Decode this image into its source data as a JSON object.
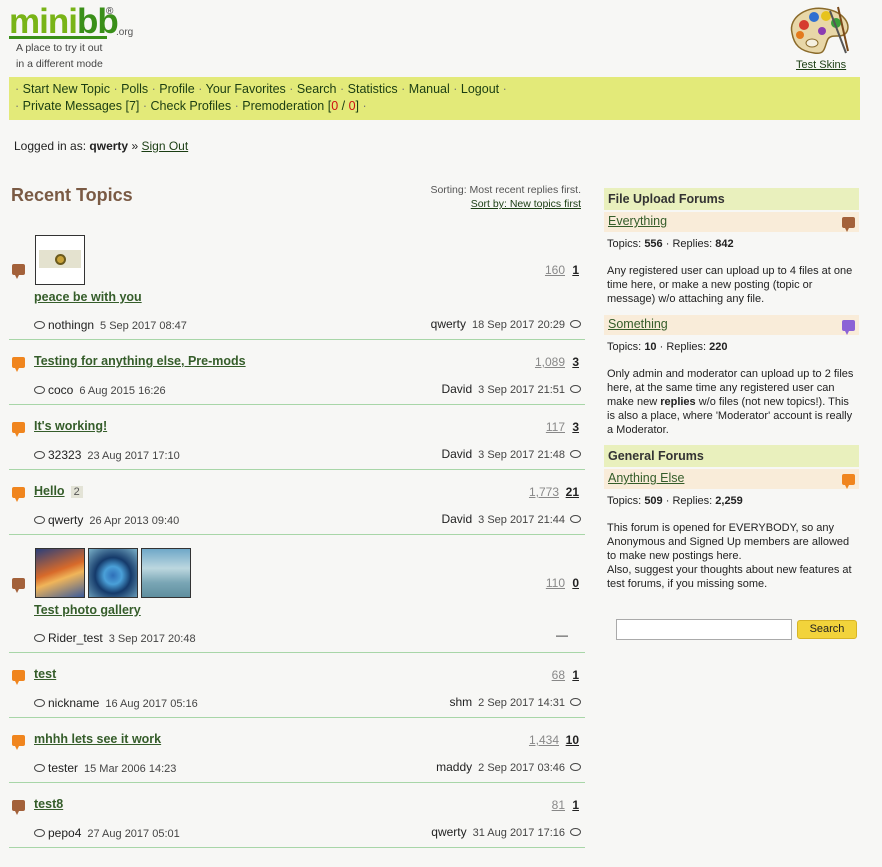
{
  "header": {
    "logo_mini": "mini",
    "logo_bb": "bb",
    "logo_reg": "®",
    "logo_org": ".org",
    "tagline_line1": "A place to try it out",
    "tagline_line2": "in a different mode",
    "test_skins": "Test Skins"
  },
  "nav": {
    "items": [
      "Start New Topic",
      "Polls",
      "Profile",
      "Your Favorites",
      "Search",
      "Statistics",
      "Manual",
      "Logout"
    ],
    "private_messages": "Private Messages",
    "private_count": "[7]",
    "check_profiles": "Check Profiles",
    "premoderation": "Premoderation",
    "premod_a": "0",
    "premod_b": "0"
  },
  "login": {
    "prefix": "Logged in as:",
    "user": "qwerty",
    "sep": "»",
    "sign_out": "Sign Out"
  },
  "recent": {
    "title": "Recent Topics",
    "sorting": "Sorting: Most recent replies first.",
    "sort_link": "Sort by: New topics first"
  },
  "topics": [
    {
      "title": "peace be with you",
      "views": "160",
      "replies": "1",
      "author": "nothingn",
      "author_date": "5 Sep 2017 08:47",
      "last_user": "qwerty",
      "last_date": "18 Sep 2017 20:29",
      "icon": "brown"
    },
    {
      "title": "Testing for anything else, Pre-mods",
      "views": "1,089",
      "replies": "3",
      "author": "coco",
      "author_date": "6 Aug 2015 16:26",
      "last_user": "David",
      "last_date": "3 Sep 2017 21:51",
      "icon": "orange"
    },
    {
      "title": "It's working!",
      "views": "117",
      "replies": "3",
      "author": "32323",
      "author_date": "23 Aug 2017 17:10",
      "last_user": "David",
      "last_date": "3 Sep 2017 21:48",
      "icon": "orange"
    },
    {
      "title": "Hello",
      "pages": "2",
      "views": "1,773",
      "replies": "21",
      "author": "qwerty",
      "author_date": "26 Apr 2013 09:40",
      "last_user": "David",
      "last_date": "3 Sep 2017 21:44",
      "icon": "orange"
    },
    {
      "title": "Test photo gallery",
      "views": "110",
      "replies": "0",
      "author": "Rider_test",
      "author_date": "3 Sep 2017 20:48",
      "last_dash": "—",
      "icon": "brown"
    },
    {
      "title": "test",
      "views": "68",
      "replies": "1",
      "author": "nickname",
      "author_date": "16 Aug 2017 05:16",
      "last_user": "shm",
      "last_date": "2 Sep 2017 14:31",
      "icon": "orange"
    },
    {
      "title": "mhhh lets see it work",
      "views": "1,434",
      "replies": "10",
      "author": "tester",
      "author_date": "15 Mar 2006 14:23",
      "last_user": "maddy",
      "last_date": "2 Sep 2017 03:46",
      "icon": "orange"
    },
    {
      "title": "test8",
      "views": "81",
      "replies": "1",
      "author": "pepo4",
      "author_date": "27 Aug 2017 05:01",
      "last_user": "qwerty",
      "last_date": "31 Aug 2017 17:16",
      "icon": "brown"
    }
  ],
  "sidebar": {
    "group1": "File Upload Forums",
    "forum1": {
      "name": "Everything",
      "topics_label": "Topics:",
      "topics": "556",
      "replies_label": "Replies:",
      "replies": "842",
      "desc": "Any registered user can upload up to 4 files at one time here, or make a new posting (topic or message) w/o attaching any file."
    },
    "forum2": {
      "name": "Something",
      "topics_label": "Topics:",
      "topics": "10",
      "replies_label": "Replies:",
      "replies": "220",
      "desc_a": "Only admin and moderator can upload up to 2 files here, at the same time any registered user can make new ",
      "desc_bold": "replies",
      "desc_b": " w/o files (not new topics!). This is also a place, where 'Moderator' account is really a Moderator."
    },
    "group2": "General Forums",
    "forum3": {
      "name": "Anything Else",
      "topics_label": "Topics:",
      "topics": "509",
      "replies_label": "Replies:",
      "replies": "2,259",
      "desc_a": "This forum is opened for EVERYBODY, so any Anonymous and Signed Up members are allowed to make new postings here.",
      "desc_b": "Also, suggest your thoughts about new features at test forums, if you missing some."
    },
    "search_placeholder": "",
    "search_button": "Search"
  },
  "colors": {
    "accent": "#e3ea79",
    "link": "#355d2a",
    "orange_icon": "#f0851e",
    "brown_icon": "#a3613a",
    "purple_icon": "#8c63d6"
  },
  "icons": [
    "palette-icon",
    "topic-icon",
    "speech-bubble-icon"
  ]
}
